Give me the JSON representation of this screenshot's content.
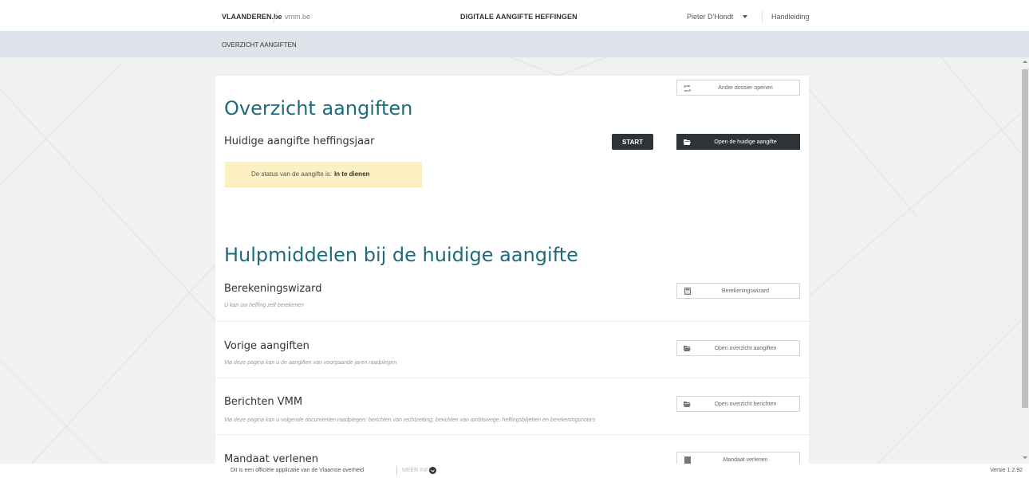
{
  "header": {
    "brand": "VLAANDEREN.be",
    "sub_brand": "vmm.be",
    "app_title": "DIGITALE AANGIFTE HEFFINGEN",
    "user": "Pieter D'Hondt",
    "manual": "Handleiding"
  },
  "subheader": {
    "title": "OVERZICHT AANGIFTEN"
  },
  "overview": {
    "heading": "Overzicht aangiften",
    "other_dossier_button": "Ander dossier openen",
    "current_title": "Huidige aangifte heffingsjaar",
    "start_button": "START",
    "open_current_button": "Open de huidige aangifte",
    "status_prefix": "De status van de aangifte is:",
    "status_value": "In te dienen"
  },
  "tools": {
    "heading": "Hulpmiddelen bij de huidige aangifte",
    "items": [
      {
        "title": "Berekeningswizard",
        "description": "U kan uw heffing zelf berekenen",
        "button": "Berekeningswizard",
        "icon": "calculator-icon"
      },
      {
        "title": "Vorige aangiften",
        "description": "Via deze pagina kan u de aangiften van voorgaande jaren raadplegen",
        "button": "Open overzicht aangiften",
        "icon": "folder-icon"
      },
      {
        "title": "Berichten VMM",
        "description": "Via deze pagina kan u volgende documenten raadplegen: berichten van rechtzetting, berichten van ambtswege, heffingsbiljetten en berekeningsnota's",
        "button": "Open overzicht berichten",
        "icon": "folder-icon"
      },
      {
        "title": "Mandaat verlenen",
        "description": "",
        "button": "Mandaat verlenen",
        "icon": "document-icon"
      }
    ]
  },
  "footer": {
    "text": "Dit is een officiële applicatie van de Vlaamse overheid",
    "more_info": "MEER INFO",
    "version": "Versie 1.2.92"
  },
  "colors": {
    "heading": "#1e6b7d",
    "dark_button": "#2e3338",
    "status_bg": "#fdf1c4",
    "subbar_bg": "#dde3e8"
  }
}
